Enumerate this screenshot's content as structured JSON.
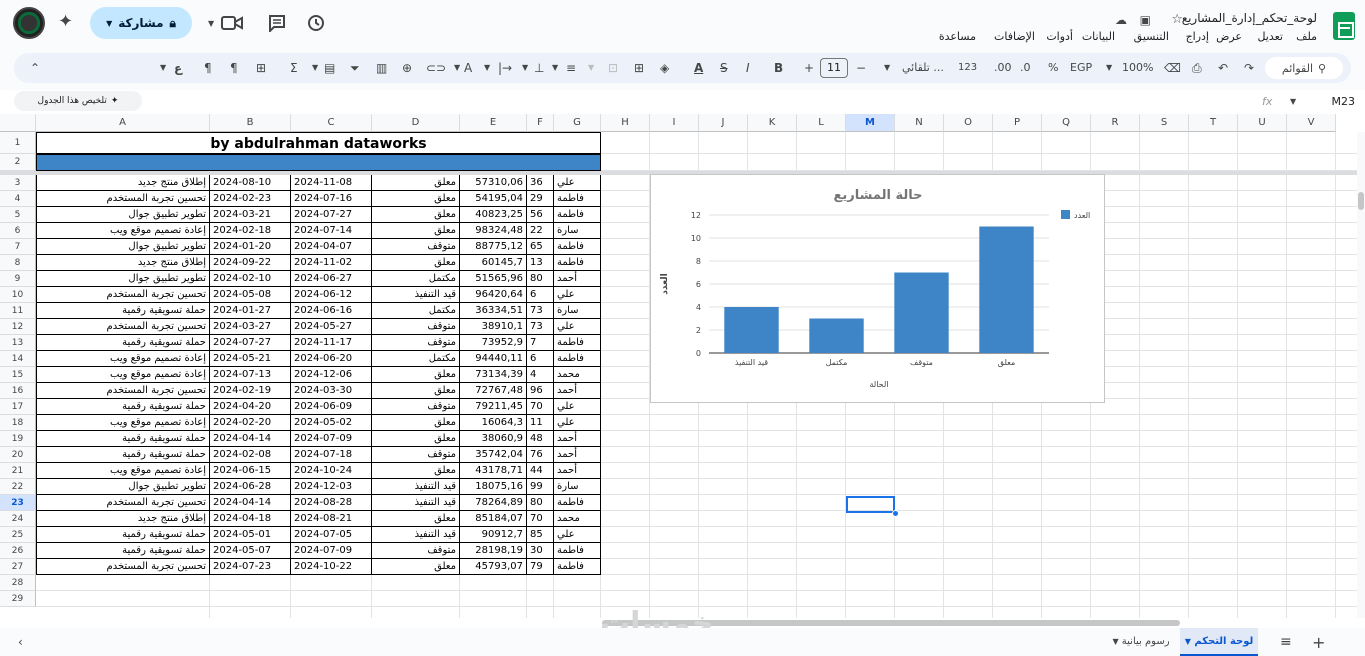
{
  "header": {
    "doc_title": "لوحة_تحكم_إدارة_المشاريع",
    "share_label": "مشاركة",
    "menu": [
      "ملف",
      "تعديل",
      "عرض",
      "إدراج",
      "التنسيق",
      "البيانات",
      "أدوات",
      "الإضافات",
      "مساعدة"
    ]
  },
  "toolbar": {
    "search_label": "القوائم",
    "zoom": "100%",
    "currency": "EGP",
    "percent": "%",
    "dec_decrease": ".0",
    "dec_increase": ".00",
    "num_format": "123",
    "font": "تلقائي ...",
    "font_size": "11"
  },
  "formula_bar": {
    "summarize_label": "تلخيص هذا الجدول",
    "namebox": "M23",
    "fx": "fx"
  },
  "columns": [
    "A",
    "B",
    "C",
    "D",
    "E",
    "F",
    "G",
    "H",
    "I",
    "J",
    "K",
    "L",
    "M",
    "N",
    "O",
    "P",
    "Q",
    "R",
    "S",
    "T",
    "U",
    "V"
  ],
  "rows": [
    "1",
    "2",
    "3",
    "4",
    "5",
    "6",
    "7",
    "8",
    "9",
    "10",
    "11",
    "12",
    "13",
    "14",
    "15",
    "16",
    "17",
    "18",
    "19",
    "20",
    "21",
    "22",
    "23",
    "24",
    "25",
    "26",
    "27",
    "28",
    "29"
  ],
  "sheet_title": "by abdulrahman dataworks",
  "table": [
    {
      "a": "إطلاق منتج جديد",
      "b": "2024-08-10",
      "c": "2024-11-08",
      "d": "معلق",
      "e": "57310,06",
      "f": "36",
      "g": "علي"
    },
    {
      "a": "تحسين تجربة المستخدم",
      "b": "2024-02-23",
      "c": "2024-07-16",
      "d": "معلق",
      "e": "54195,04",
      "f": "29",
      "g": "فاطمة"
    },
    {
      "a": "تطوير تطبيق جوال",
      "b": "2024-03-21",
      "c": "2024-07-27",
      "d": "معلق",
      "e": "40823,25",
      "f": "56",
      "g": "فاطمة"
    },
    {
      "a": "إعادة تصميم موقع ويب",
      "b": "2024-02-18",
      "c": "2024-07-14",
      "d": "معلق",
      "e": "98324,48",
      "f": "22",
      "g": "سارة"
    },
    {
      "a": "تطوير تطبيق جوال",
      "b": "2024-01-20",
      "c": "2024-04-07",
      "d": "متوقف",
      "e": "88775,12",
      "f": "65",
      "g": "فاطمة"
    },
    {
      "a": "إطلاق منتج جديد",
      "b": "2024-09-22",
      "c": "2024-11-02",
      "d": "معلق",
      "e": "60145,7",
      "f": "13",
      "g": "فاطمة"
    },
    {
      "a": "تطوير تطبيق جوال",
      "b": "2024-02-10",
      "c": "2024-06-27",
      "d": "مكتمل",
      "e": "51565,96",
      "f": "80",
      "g": "أحمد"
    },
    {
      "a": "تحسين تجربة المستخدم",
      "b": "2024-05-08",
      "c": "2024-06-12",
      "d": "قيد التنفيذ",
      "e": "96420,64",
      "f": "6",
      "g": "علي"
    },
    {
      "a": "حملة تسويقية رقمية",
      "b": "2024-01-27",
      "c": "2024-06-16",
      "d": "مكتمل",
      "e": "36334,51",
      "f": "73",
      "g": "سارة"
    },
    {
      "a": "تحسين تجربة المستخدم",
      "b": "2024-03-27",
      "c": "2024-05-27",
      "d": "متوقف",
      "e": "38910,1",
      "f": "73",
      "g": "علي"
    },
    {
      "a": "حملة تسويقية رقمية",
      "b": "2024-07-27",
      "c": "2024-11-17",
      "d": "متوقف",
      "e": "73952,9",
      "f": "7",
      "g": "فاطمة"
    },
    {
      "a": "إعادة تصميم موقع ويب",
      "b": "2024-05-21",
      "c": "2024-06-20",
      "d": "مكتمل",
      "e": "94440,11",
      "f": "6",
      "g": "فاطمة"
    },
    {
      "a": "إعادة تصميم موقع ويب",
      "b": "2024-07-13",
      "c": "2024-12-06",
      "d": "معلق",
      "e": "73134,39",
      "f": "4",
      "g": "محمد"
    },
    {
      "a": "تحسين تجربة المستخدم",
      "b": "2024-02-19",
      "c": "2024-03-30",
      "d": "معلق",
      "e": "72767,48",
      "f": "96",
      "g": "أحمد"
    },
    {
      "a": "حملة تسويقية رقمية",
      "b": "2024-04-20",
      "c": "2024-06-09",
      "d": "متوقف",
      "e": "79211,45",
      "f": "70",
      "g": "علي"
    },
    {
      "a": "إعادة تصميم موقع ويب",
      "b": "2024-02-20",
      "c": "2024-05-02",
      "d": "معلق",
      "e": "16064,3",
      "f": "11",
      "g": "علي"
    },
    {
      "a": "حملة تسويقية رقمية",
      "b": "2024-04-14",
      "c": "2024-07-09",
      "d": "معلق",
      "e": "38060,9",
      "f": "48",
      "g": "أحمد"
    },
    {
      "a": "حملة تسويقية رقمية",
      "b": "2024-02-08",
      "c": "2024-07-18",
      "d": "متوقف",
      "e": "35742,04",
      "f": "76",
      "g": "أحمد"
    },
    {
      "a": "إعادة تصميم موقع ويب",
      "b": "2024-06-15",
      "c": "2024-10-24",
      "d": "معلق",
      "e": "43178,71",
      "f": "44",
      "g": "أحمد"
    },
    {
      "a": "تطوير تطبيق جوال",
      "b": "2024-06-28",
      "c": "2024-12-03",
      "d": "قيد التنفيذ",
      "e": "18075,16",
      "f": "99",
      "g": "سارة"
    },
    {
      "a": "تحسين تجربة المستخدم",
      "b": "2024-04-14",
      "c": "2024-08-28",
      "d": "قيد التنفيذ",
      "e": "78264,89",
      "f": "80",
      "g": "فاطمة"
    },
    {
      "a": "إطلاق منتج جديد",
      "b": "2024-04-18",
      "c": "2024-08-21",
      "d": "معلق",
      "e": "85184,07",
      "f": "70",
      "g": "محمد"
    },
    {
      "a": "حملة تسويقية رقمية",
      "b": "2024-05-01",
      "c": "2024-07-05",
      "d": "قيد التنفيذ",
      "e": "90912,7",
      "f": "85",
      "g": "علي"
    },
    {
      "a": "حملة تسويقية رقمية",
      "b": "2024-05-07",
      "c": "2024-07-09",
      "d": "متوقف",
      "e": "28198,19",
      "f": "30",
      "g": "فاطمة"
    },
    {
      "a": "تحسين تجربة المستخدم",
      "b": "2024-07-23",
      "c": "2024-10-22",
      "d": "معلق",
      "e": "45793,07",
      "f": "79",
      "g": "فاطمة"
    }
  ],
  "chart_data": {
    "type": "bar",
    "title": "حالة المشاريع",
    "xlabel": "الحالة",
    "ylabel": "العدد",
    "categories": [
      "قيد التنفيذ",
      "مكتمل",
      "متوقف",
      "معلق"
    ],
    "series": [
      {
        "name": "العدد",
        "values": [
          4,
          3,
          7,
          11
        ],
        "color": "#3d85c6"
      }
    ],
    "ylim": [
      0,
      12
    ],
    "yticks": [
      "0",
      "2",
      "4",
      "6",
      "8",
      "10",
      "12"
    ],
    "legend": "top-right",
    "grid": true
  },
  "sheets": [
    {
      "label": "لوحة التحكم",
      "active": true
    },
    {
      "label": "رسوم بيانية",
      "active": false
    }
  ],
  "watermark": "خمسات"
}
